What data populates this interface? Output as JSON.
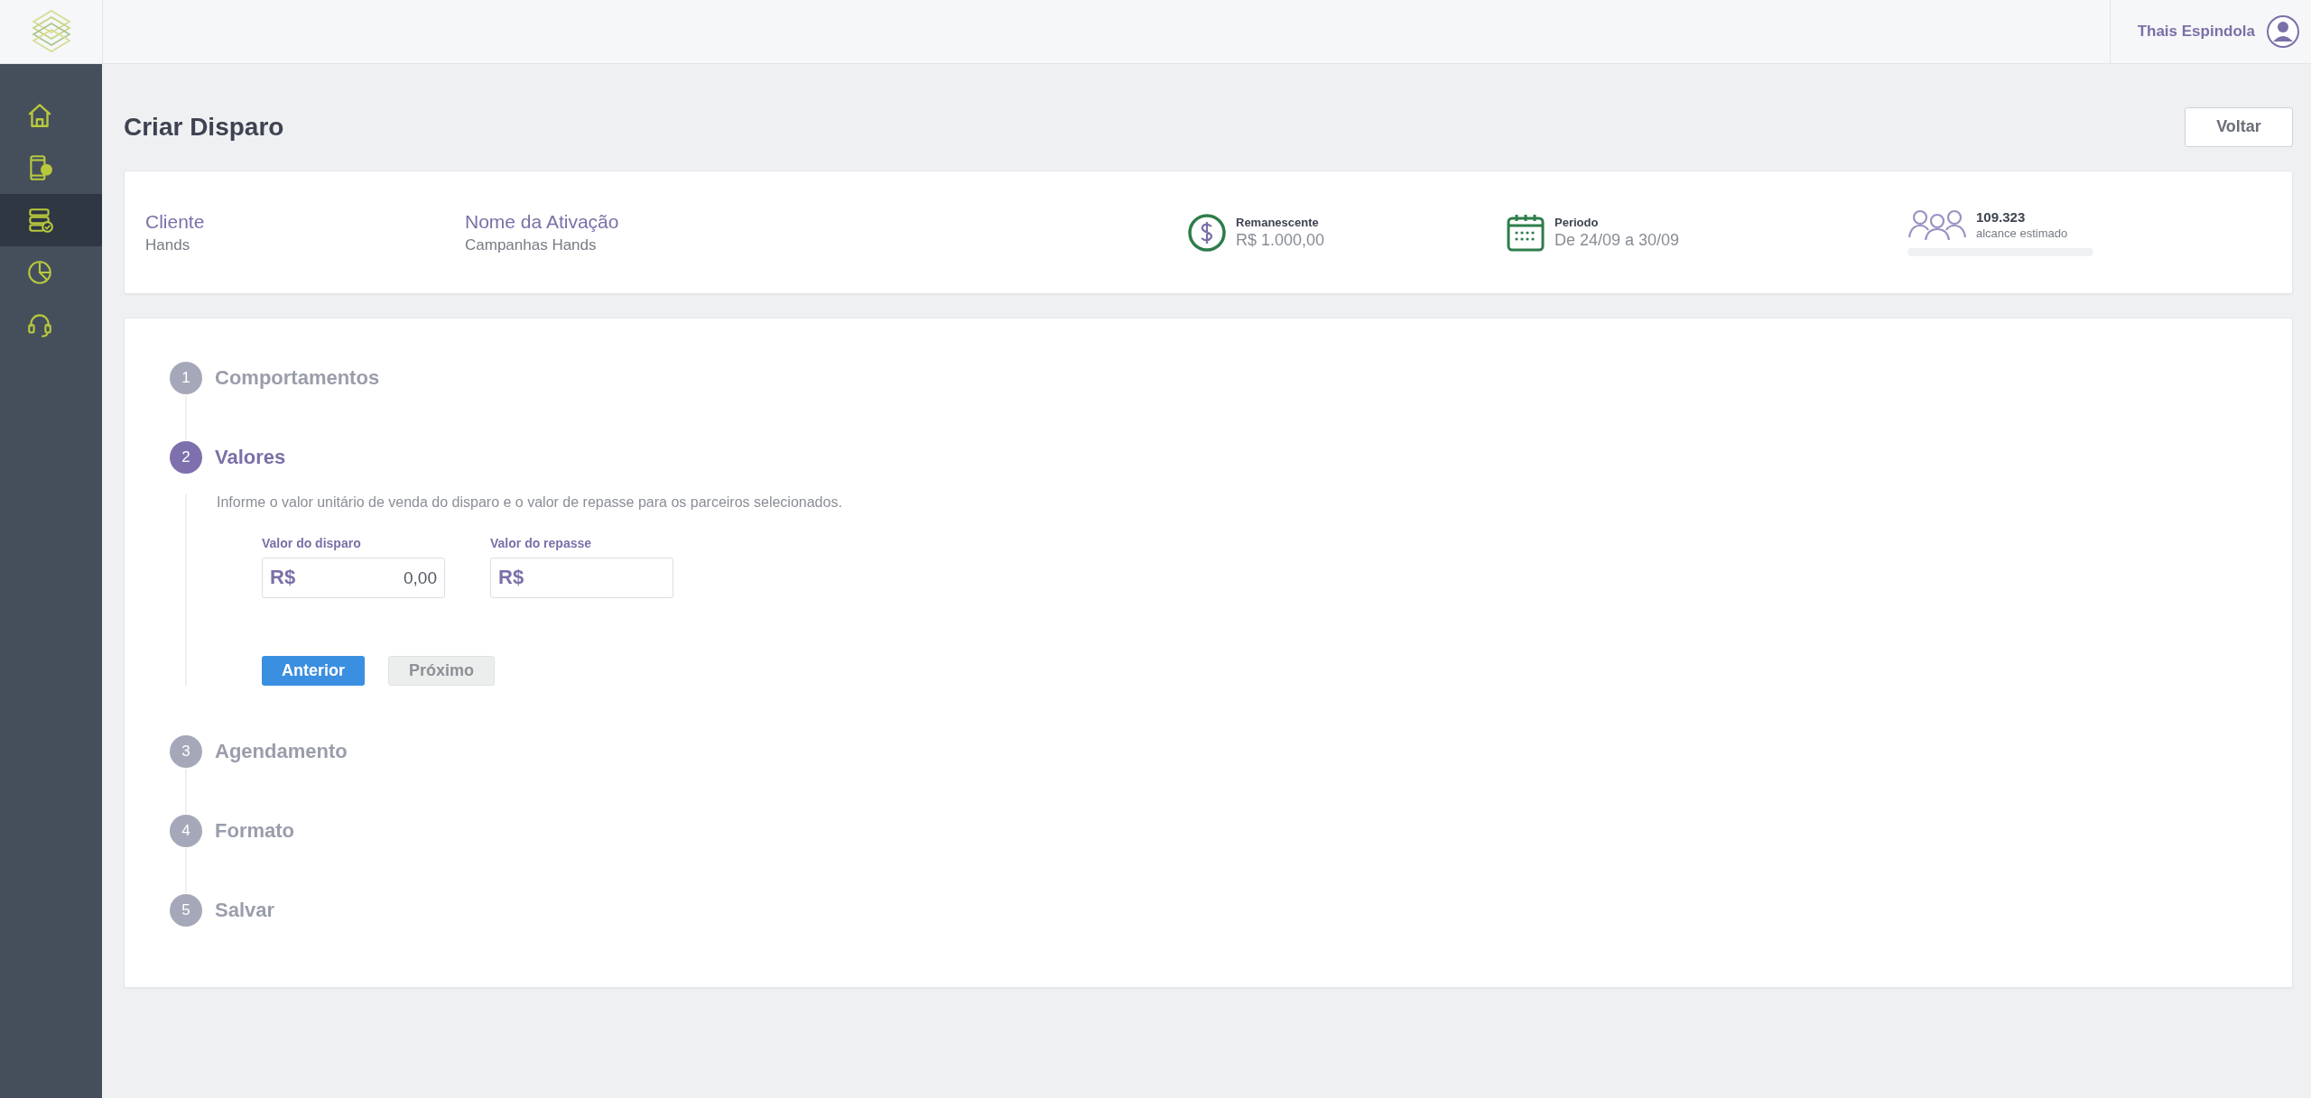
{
  "header": {
    "user_name": "Thais Espindola"
  },
  "sidebar": {
    "items": [
      {
        "selected": false
      },
      {
        "selected": false
      },
      {
        "selected": true
      },
      {
        "selected": false
      },
      {
        "selected": false
      }
    ]
  },
  "page": {
    "title": "Criar Disparo",
    "back_button": "Voltar"
  },
  "info": {
    "client": {
      "label": "Cliente",
      "value": "Hands"
    },
    "activation": {
      "label": "Nome da Ativação",
      "value": "Campanhas Hands"
    },
    "remaining": {
      "label": "Remanescente",
      "value": "R$ 1.000,00"
    },
    "period": {
      "label": "Periodo",
      "value": "De 24/09 a 30/09"
    },
    "reach": {
      "value": "109.323",
      "label": "alcance estimado"
    }
  },
  "steps": [
    {
      "number": "1",
      "label": "Comportamentos",
      "active": false
    },
    {
      "number": "2",
      "label": "Valores",
      "active": true
    },
    {
      "number": "3",
      "label": "Agendamento",
      "active": false
    },
    {
      "number": "4",
      "label": "Formato",
      "active": false
    },
    {
      "number": "5",
      "label": "Salvar",
      "active": false
    }
  ],
  "values_step": {
    "description": "Informe o valor unitário de venda do disparo e o valor de repasse para os parceiros selecionados.",
    "fields": [
      {
        "label": "Valor do disparo",
        "prefix": "R$",
        "value": "0,00"
      },
      {
        "label": "Valor do repasse",
        "prefix": "R$"
      }
    ],
    "buttons": [
      {
        "label": "Anterior",
        "disabled": false
      },
      {
        "label": "Próximo",
        "disabled": true
      }
    ]
  }
}
